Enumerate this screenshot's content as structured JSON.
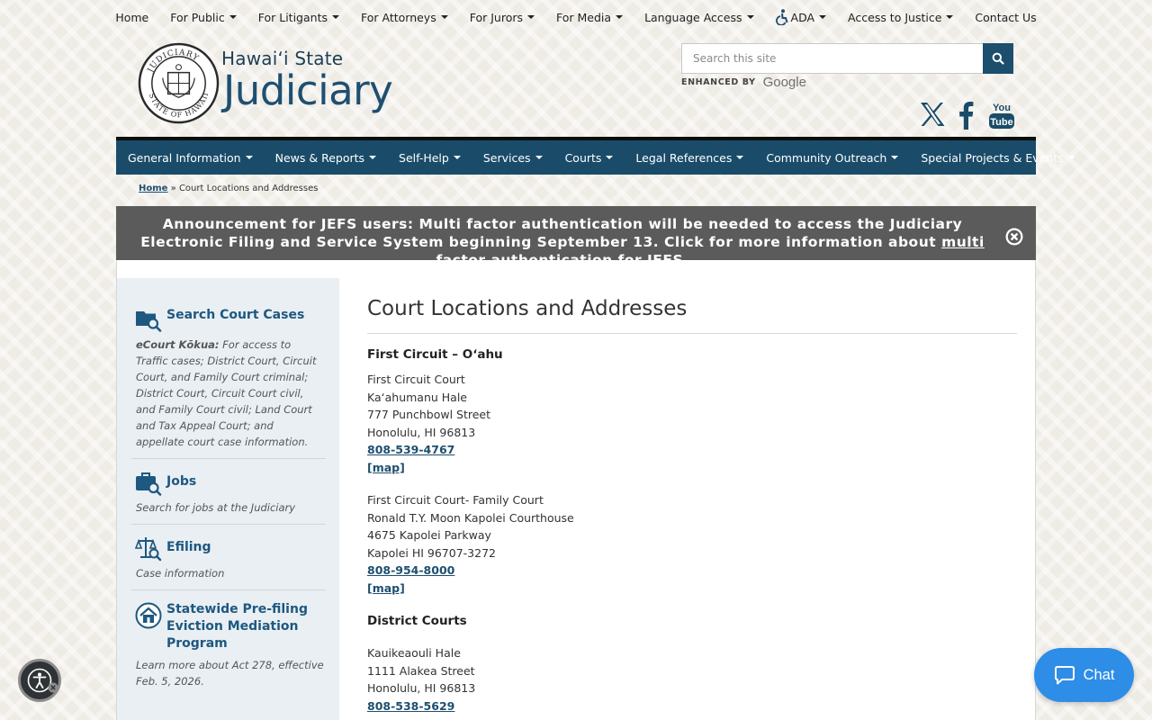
{
  "topnav": {
    "items": [
      {
        "label": "Home",
        "caret": false
      },
      {
        "label": "For Public",
        "caret": true
      },
      {
        "label": "For Litigants",
        "caret": true
      },
      {
        "label": "For Attorneys",
        "caret": true
      },
      {
        "label": "For Jurors",
        "caret": true
      },
      {
        "label": "For Media",
        "caret": true
      },
      {
        "label": "Language Access",
        "caret": true
      },
      {
        "label": "ADA",
        "caret": true,
        "icon": "accessibility-icon"
      },
      {
        "label": "Access to Justice",
        "caret": true
      },
      {
        "label": "Contact Us",
        "caret": false
      }
    ]
  },
  "header": {
    "site_title_small": "Hawaiʻi State",
    "site_title_big": "Judiciary",
    "seal_text_top": "JUDICIARY",
    "seal_text_bottom": "STATE OF HAWAII"
  },
  "search": {
    "placeholder": "Search this site",
    "enhanced_label": "ENHANCED BY",
    "google_label": "Google"
  },
  "social": {
    "youtube_top": "You",
    "youtube_bottom": "Tube"
  },
  "mainnav": {
    "items": [
      "General Information",
      "News & Reports",
      "Self-Help",
      "Services",
      "Courts",
      "Legal References",
      "Community Outreach",
      "Special Projects & Events"
    ]
  },
  "breadcrumb": {
    "home": "Home",
    "separator": "»",
    "current": "Court Locations and Addresses"
  },
  "announcement": {
    "text": "Announcement for JEFS users: Multi factor authentication will be needed to access the Judiciary Electronic Filing and Service System beginning September 13. Click for more information about",
    "link_text": "multi factor authentication for JEFS."
  },
  "sidebar": {
    "search": {
      "title": "Search Court Cases",
      "desc_bold": "eCourt Kōkua:",
      "desc": " For access to Traffic cases; District Court, Circuit Court, and Family Court criminal; District Court, Circuit Court civil, and Family Court civil; Land Court and Tax Appeal Court; and appellate court case information."
    },
    "jobs": {
      "title": "Jobs",
      "desc": "Search for jobs at the Judiciary"
    },
    "efiling": {
      "title": "Efiling",
      "desc": "Case information"
    },
    "eviction": {
      "title": "Statewide Pre-filing Eviction Mediation Program",
      "desc": "Learn more about Act 278, effective Feb. 5, 2026."
    }
  },
  "main": {
    "title": "Court Locations and Addresses",
    "section1": "First Circuit – Oʻahu",
    "court1": {
      "lines": [
        "First Circuit Court",
        "Kaʻahumanu Hale",
        "777 Punchbowl Street",
        "Honolulu, HI 96813"
      ],
      "phone": "808-539-4767",
      "map": "[map]"
    },
    "court2": {
      "lines": [
        "First Circuit Court- Family Court",
        "Ronald T.Y. Moon Kapolei Courthouse",
        "4675 Kapolei Parkway",
        "Kapolei HI 96707-3272"
      ],
      "phone": "808-954-8000",
      "map": "[map]"
    },
    "section2": "District Courts",
    "court3": {
      "lines": [
        "Kauikeaouli Hale",
        "1111 Alakea Street",
        "Honolulu, HI 96813"
      ],
      "phone": "808-538-5629"
    }
  },
  "chat": {
    "label": "Chat"
  },
  "colors": {
    "brand_navy": "#1a4c69",
    "link": "#1e4f70",
    "chat": "#2e8de6",
    "announce_bg": "#5b5b5b"
  }
}
